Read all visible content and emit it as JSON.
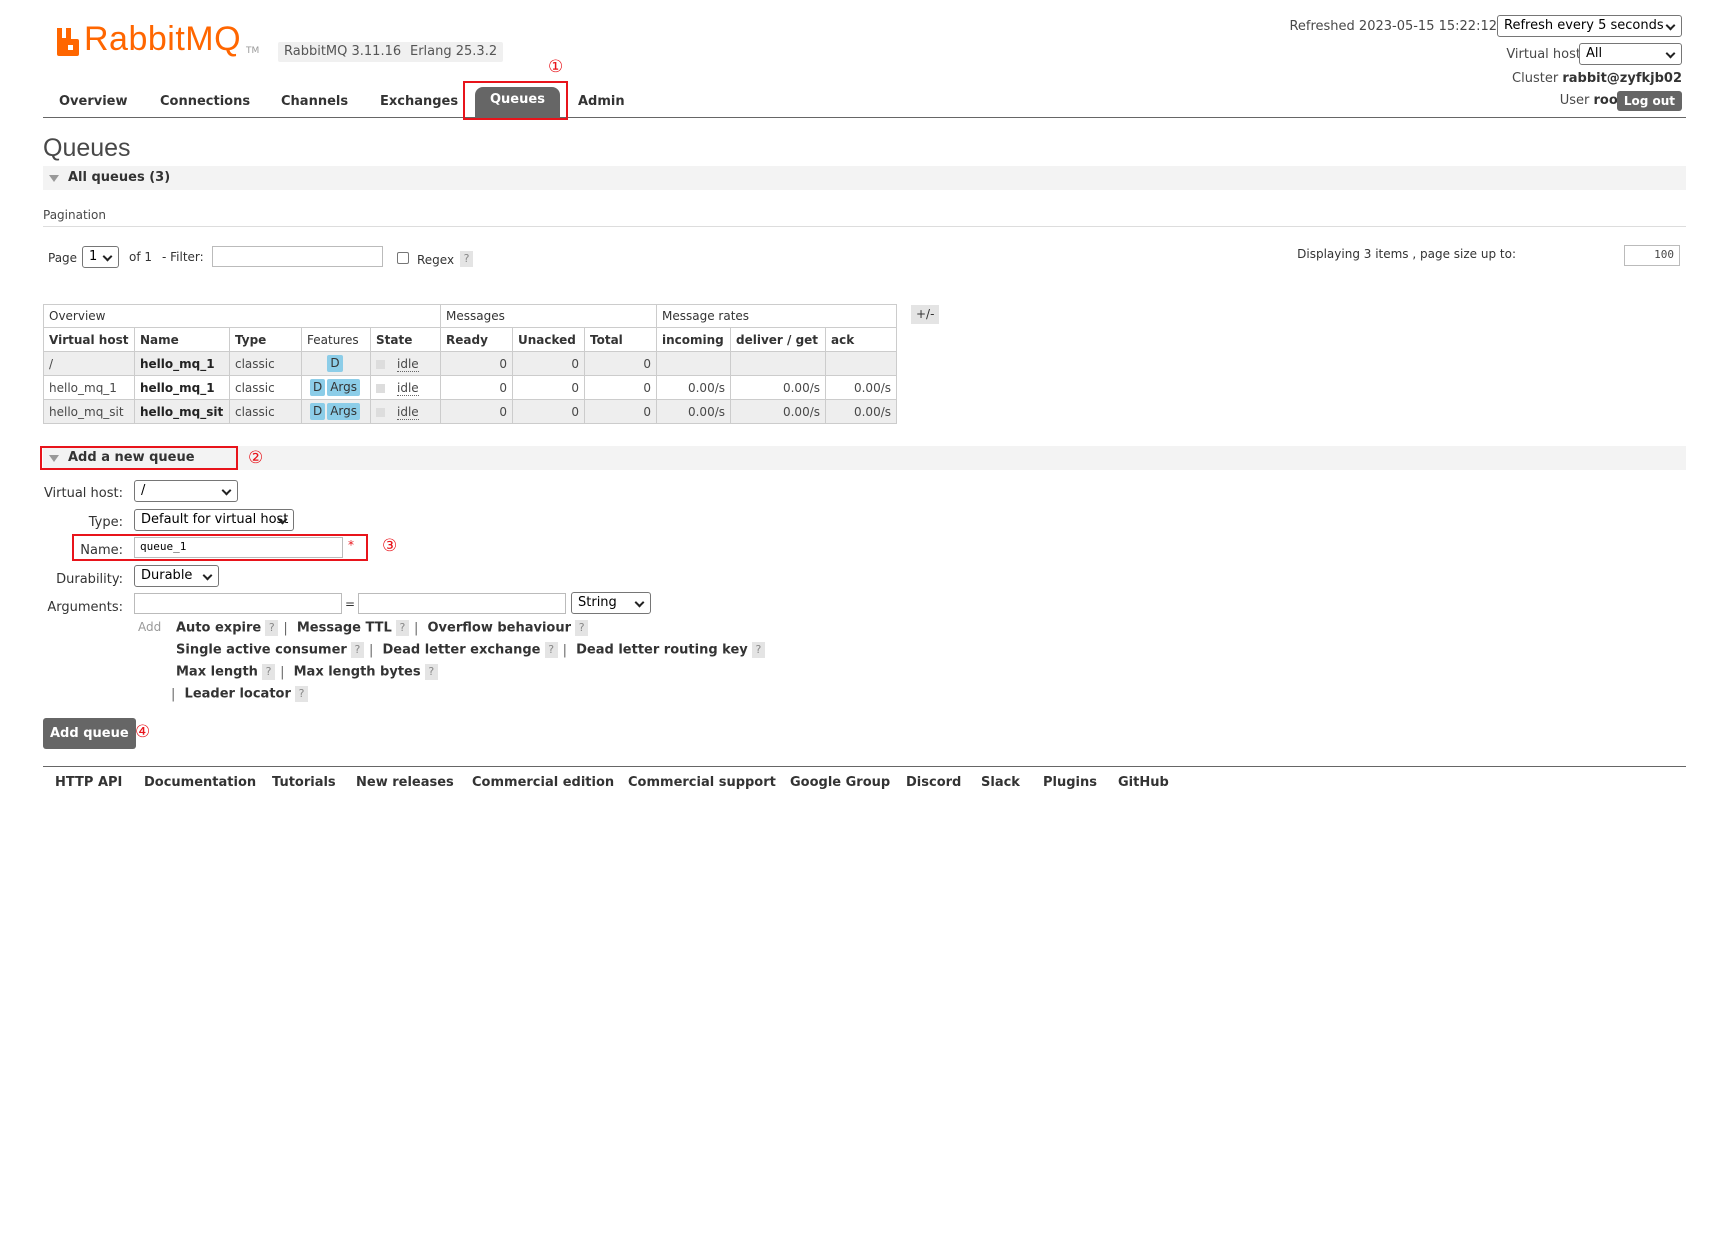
{
  "header": {
    "logo_text": "RabbitMQ",
    "logo_tm": "TM",
    "version": "RabbitMQ 3.11.16",
    "erlang": "Erlang 25.3.2",
    "refreshed_label": "Refreshed 2023-05-15 15:22:12",
    "refresh_select": "Refresh every 5 seconds",
    "vhost_label": "Virtual host",
    "vhost_select": "All",
    "cluster_label": "Cluster",
    "cluster_name": "rabbit@zyfkjb02",
    "user_label": "User",
    "user_name": "root",
    "logout": "Log out"
  },
  "nav": {
    "items": [
      "Overview",
      "Connections",
      "Channels",
      "Exchanges",
      "Queues",
      "Admin"
    ],
    "active": "Queues"
  },
  "annotations": {
    "n1": "①",
    "n2": "②",
    "n3": "③",
    "n4": "④",
    "color": "#e8141b"
  },
  "page": {
    "title": "Queues",
    "all_queues": "All queues (3)"
  },
  "pagination": {
    "section": "Pagination",
    "page_label": "Page",
    "page_value": "1",
    "of_label": "of 1",
    "filter_label": "- Filter:",
    "filter_value": "",
    "regex_label": "Regex",
    "help": "?",
    "displaying": "Displaying 3 items , page size up to:",
    "page_size": "100"
  },
  "table": {
    "groups": [
      "Overview",
      "Messages",
      "Message rates"
    ],
    "columns": [
      "Virtual host",
      "Name",
      "Type",
      "Features",
      "State",
      "Ready",
      "Unacked",
      "Total",
      "incoming",
      "deliver / get",
      "ack"
    ],
    "plusminus": "+/-",
    "rows": [
      {
        "vhost": "/",
        "name": "hello_mq_1",
        "type": "classic",
        "features": [
          "D"
        ],
        "state": "idle",
        "ready": "0",
        "unacked": "0",
        "total": "0",
        "incoming": "",
        "deliver": "",
        "ack": ""
      },
      {
        "vhost": "hello_mq_1",
        "name": "hello_mq_1",
        "type": "classic",
        "features": [
          "D",
          "Args"
        ],
        "state": "idle",
        "ready": "0",
        "unacked": "0",
        "total": "0",
        "incoming": "0.00/s",
        "deliver": "0.00/s",
        "ack": "0.00/s"
      },
      {
        "vhost": "hello_mq_sit",
        "name": "hello_mq_sit",
        "type": "classic",
        "features": [
          "D",
          "Args"
        ],
        "state": "idle",
        "ready": "0",
        "unacked": "0",
        "total": "0",
        "incoming": "0.00/s",
        "deliver": "0.00/s",
        "ack": "0.00/s"
      }
    ]
  },
  "add_queue": {
    "section": "Add a new queue",
    "vhost_label": "Virtual host:",
    "vhost_value": "/",
    "type_label": "Type:",
    "type_value": "Default for virtual host",
    "name_label": "Name:",
    "name_value": "queue_1",
    "required_mark": "*",
    "durability_label": "Durability:",
    "durability_value": "Durable",
    "arguments_label": "Arguments:",
    "arg_key": "",
    "equals": "=",
    "arg_value": "",
    "arg_type": "String",
    "add_label": "Add",
    "help": "?",
    "links": {
      "auto_expire": "Auto expire",
      "message_ttl": "Message TTL",
      "overflow": "Overflow behaviour",
      "single_active": "Single active consumer",
      "dlx": "Dead letter exchange",
      "dlrk": "Dead letter routing key",
      "max_length": "Max length",
      "max_length_bytes": "Max length bytes",
      "leader_locator": "Leader locator"
    },
    "separator": "|",
    "submit": "Add queue"
  },
  "footer": [
    "HTTP API",
    "Documentation",
    "Tutorials",
    "New releases",
    "Commercial edition",
    "Commercial support",
    "Google Group",
    "Discord",
    "Slack",
    "Plugins",
    "GitHub"
  ]
}
